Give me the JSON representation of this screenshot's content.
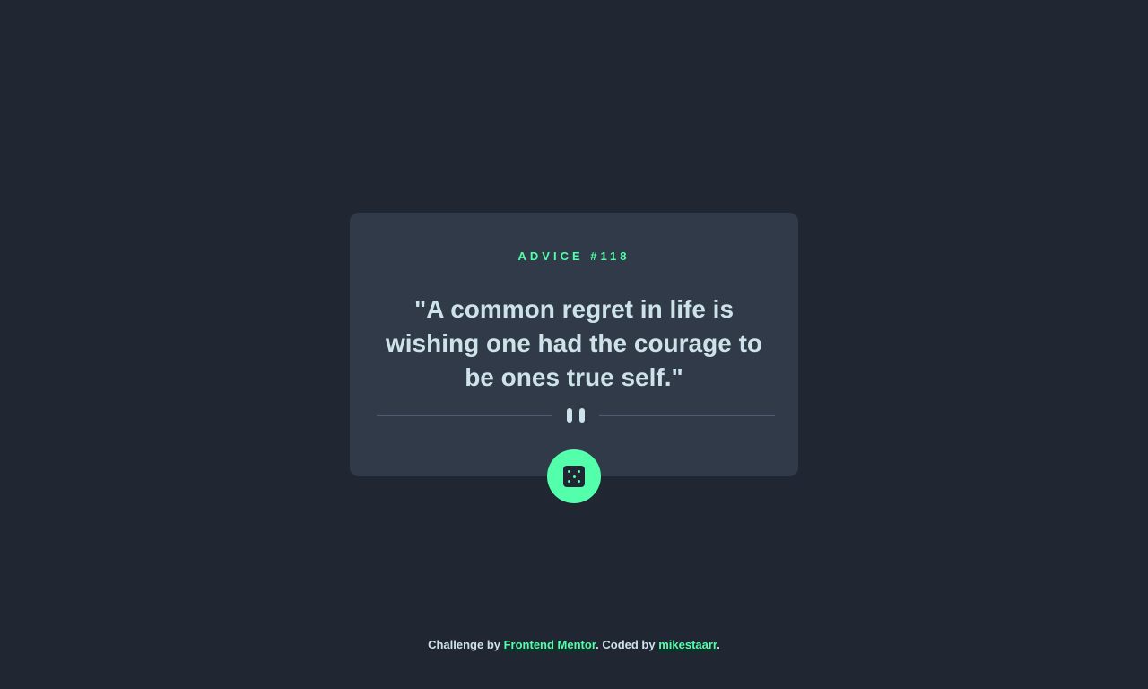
{
  "card": {
    "advice_label": "ADVICE #118",
    "advice_text": "\"A common regret in life is wishing one had the courage to be ones true self.\"",
    "divider_icon": "pause-icon"
  },
  "generate_button": {
    "icon": "dice-icon"
  },
  "footer": {
    "challenge_prefix": "Challenge by ",
    "challenge_link": "Frontend Mentor",
    "coded_prefix": ". Coded by ",
    "author_link": "mikestaarr",
    "suffix": "."
  },
  "colors": {
    "background": "#202632",
    "card": "#313a48",
    "accent": "#53ffaa",
    "text": "#cee3e9",
    "divider": "#4f5d74"
  }
}
